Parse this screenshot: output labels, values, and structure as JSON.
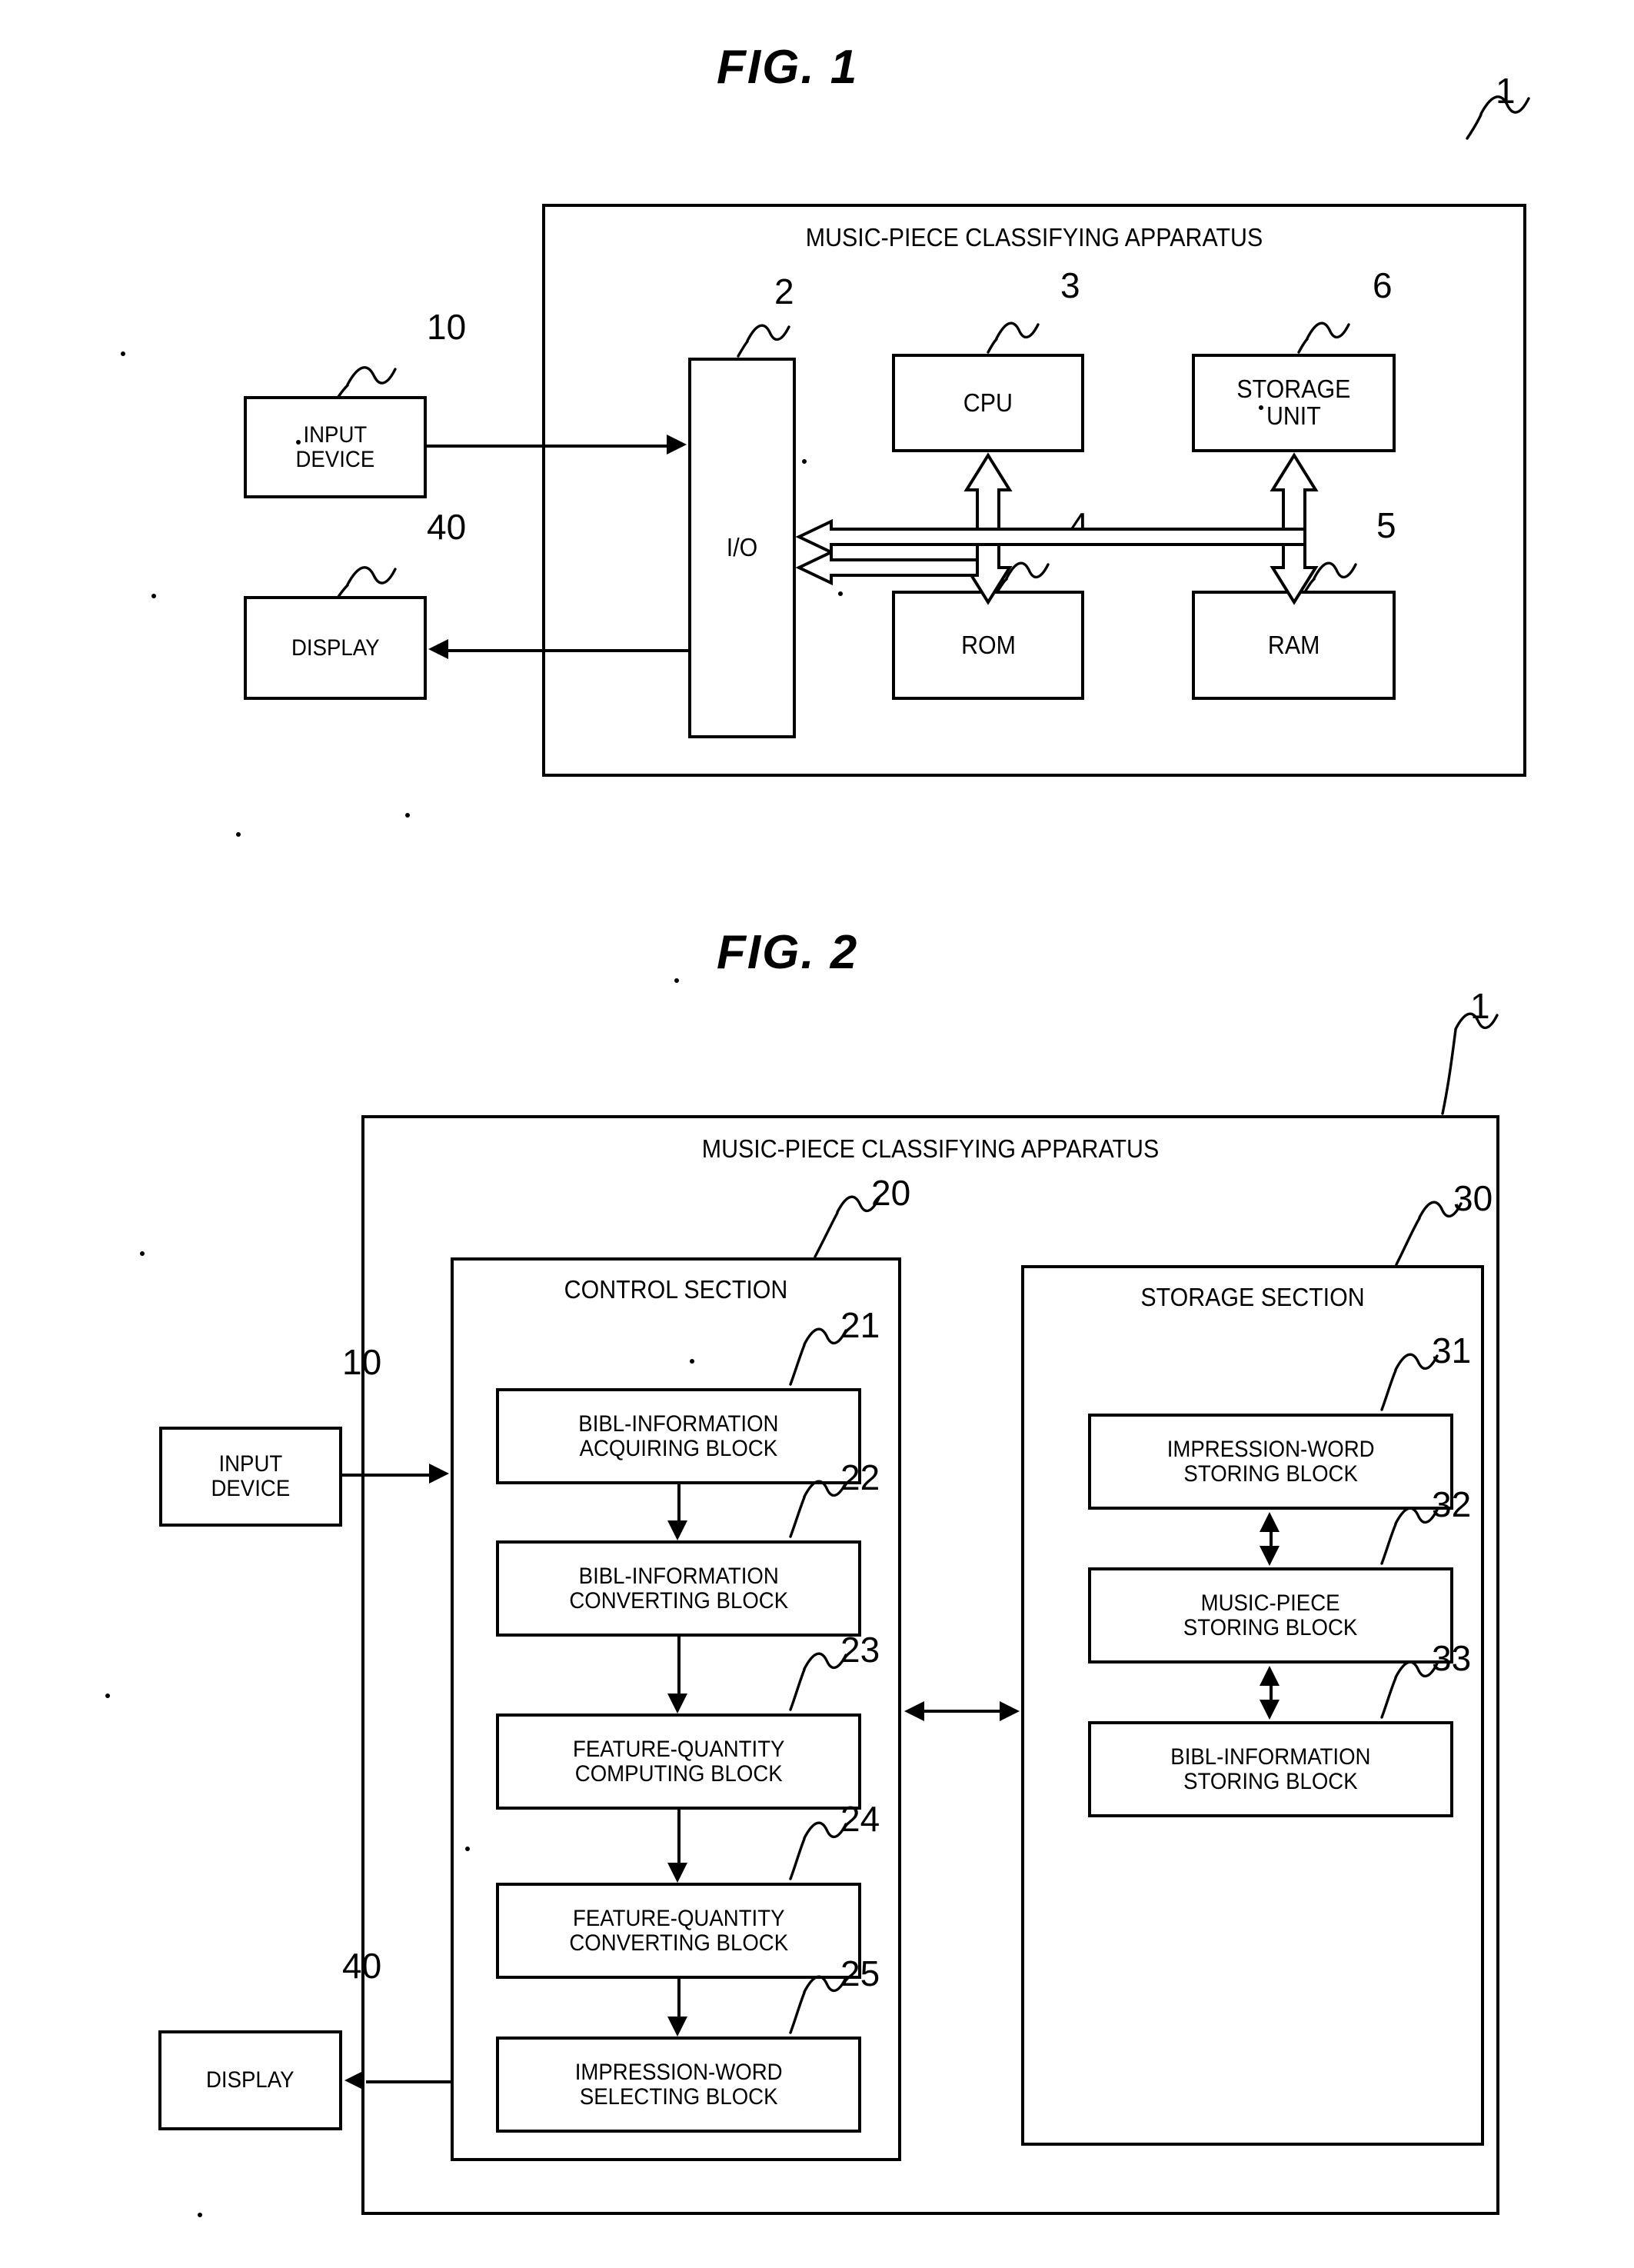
{
  "figures": [
    {
      "title": "FIG.  1",
      "apparatus": {
        "label": "MUSIC-PIECE CLASSIFYING APPARATUS",
        "ref": "1"
      },
      "external": [
        {
          "label": "INPUT\nDEVICE",
          "ref": "10"
        },
        {
          "label": "DISPLAY",
          "ref": "40"
        }
      ],
      "internal": [
        {
          "label": "I/O",
          "ref": "2"
        },
        {
          "label": "CPU",
          "ref": "3"
        },
        {
          "label": "ROM",
          "ref": "4"
        },
        {
          "label": "RAM",
          "ref": "5"
        },
        {
          "label": "STORAGE\nUNIT",
          "ref": "6"
        }
      ]
    },
    {
      "title": "FIG.  2",
      "apparatus": {
        "label": "MUSIC-PIECE CLASSIFYING APPARATUS",
        "ref": "1"
      },
      "external": [
        {
          "label": "INPUT\nDEVICE",
          "ref": "10"
        },
        {
          "label": "DISPLAY",
          "ref": "40"
        }
      ],
      "control_section": {
        "label": "CONTROL SECTION",
        "ref": "20",
        "blocks": [
          {
            "label": "BIBL-INFORMATION\nACQUIRING BLOCK",
            "ref": "21"
          },
          {
            "label": "BIBL-INFORMATION\nCONVERTING BLOCK",
            "ref": "22"
          },
          {
            "label": "FEATURE-QUANTITY\nCOMPUTING BLOCK",
            "ref": "23"
          },
          {
            "label": "FEATURE-QUANTITY\nCONVERTING BLOCK",
            "ref": "24"
          },
          {
            "label": "IMPRESSION-WORD\nSELECTING BLOCK",
            "ref": "25"
          }
        ]
      },
      "storage_section": {
        "label": "STORAGE SECTION",
        "ref": "30",
        "blocks": [
          {
            "label": "IMPRESSION-WORD\nSTORING BLOCK",
            "ref": "31"
          },
          {
            "label": "MUSIC-PIECE\nSTORING BLOCK",
            "ref": "32"
          },
          {
            "label": "BIBL-INFORMATION\nSTORING BLOCK",
            "ref": "33"
          }
        ]
      }
    }
  ]
}
